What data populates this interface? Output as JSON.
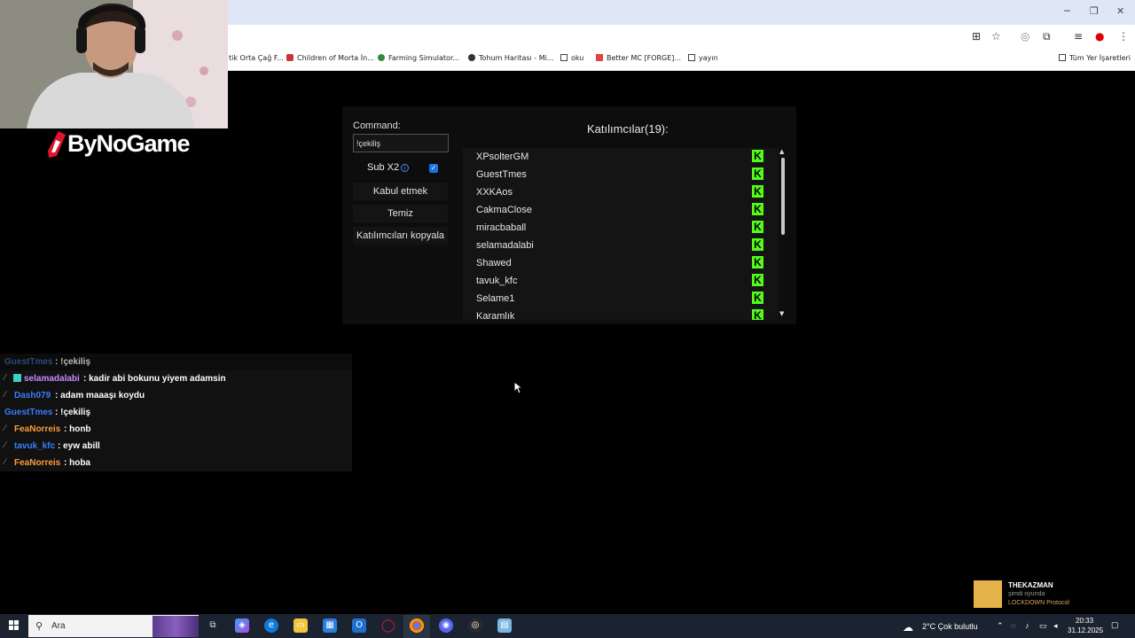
{
  "bookmarks": [
    "tik Orta Çağ F...",
    "Children of Morta İn...",
    "Farming Simulator...",
    "Tohum Haritası - Mi...",
    "oku",
    "Better MC [FORGE]...",
    "yayın",
    "Tüm Yer İşaretleri"
  ],
  "logo": {
    "text": "ByNoGame"
  },
  "panel": {
    "command_label": "Command:",
    "command_value": "!çekiliş",
    "sub_label": "Sub X2",
    "sub_checked": true,
    "accept_button": "Kabul etmek",
    "clear_button": "Temiz",
    "copy_button": "Katılımcıları kopyala",
    "participants_title": "Katılımcılar(19):",
    "participants": [
      "XPsolterGM",
      "GuestTmes",
      "XXKAos",
      "CakmaClose",
      "miracbaball",
      "selamadalabi",
      "Shawed",
      "tavuk_kfc",
      "Selame1",
      "Karamlık"
    ],
    "platform_icon": "kick-icon",
    "accent_color": "#53fc18"
  },
  "chat": [
    {
      "user": "GuestTmes",
      "msg": ": !çekiliş",
      "color": "#3b6fc9",
      "faded": true,
      "slash": false,
      "badge": false
    },
    {
      "user": "selamadalabi",
      "msg": ": kadir abi bokunu yiyem adamsin",
      "color": "#c88bff",
      "faded": false,
      "slash": true,
      "badge": true
    },
    {
      "user": "Dash079",
      "msg": ": adam maaaşı koydu",
      "color": "#3b7dff",
      "faded": false,
      "slash": true,
      "badge": false
    },
    {
      "user": "GuestTmes",
      "msg": ": !çekiliş",
      "color": "#3b7dff",
      "faded": false,
      "slash": false,
      "badge": false
    },
    {
      "user": "FeaNorreis",
      "msg": ": honb",
      "color": "#ff9a3c",
      "faded": false,
      "slash": true,
      "badge": false
    },
    {
      "user": "tavuk_kfc",
      "msg": ": eyw abill",
      "color": "#3b7dff",
      "faded": false,
      "slash": true,
      "badge": false
    },
    {
      "user": "FeaNorreis",
      "msg": ": hoba",
      "color": "#ff9a3c",
      "faded": false,
      "slash": true,
      "badge": false
    }
  ],
  "alert": {
    "name": "THEKAZMAN",
    "status": "şimdi oyunda",
    "game": "LOCKDOWN Protocol"
  },
  "taskbar": {
    "search_placeholder": "Ara",
    "weather": "2°C Çok bulutlu",
    "time": "20:33",
    "date": "31.12.2025"
  }
}
